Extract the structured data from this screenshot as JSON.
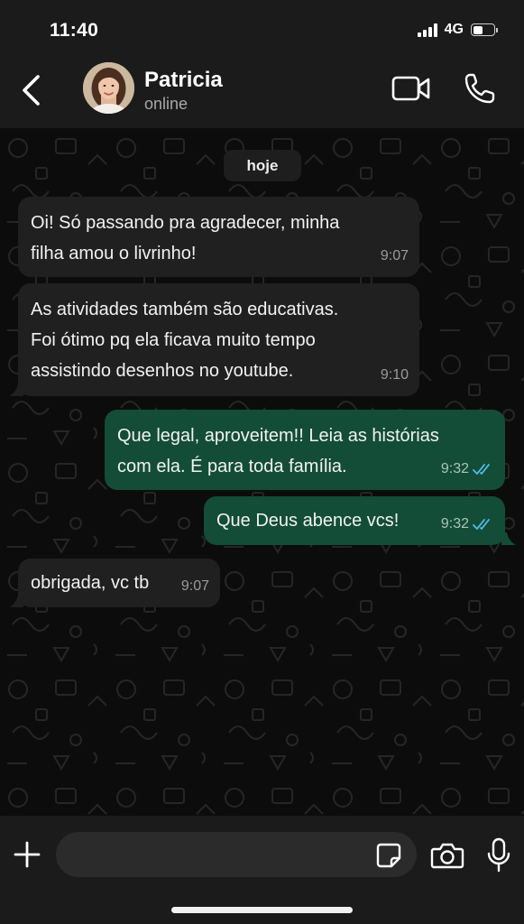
{
  "status_bar": {
    "time": "11:40",
    "network": "4G",
    "battery_level": 0.5
  },
  "header": {
    "contact_name": "Patricia",
    "contact_status": "online",
    "icons": [
      "chevron-left-icon",
      "avatar",
      "video-call-icon",
      "phone-call-icon"
    ]
  },
  "chat": {
    "date_label": "hoje",
    "messages": [
      {
        "direction": "in",
        "lines": [
          "Oi! Só passando pra agradecer, minha",
          "filha amou o livrinho!"
        ],
        "time": "9:07"
      },
      {
        "direction": "in",
        "lines": [
          "As atividades também são educativas.",
          "Foi ótimo pq ela ficava muito tempo",
          "assistindo desenhos no youtube."
        ],
        "time": "9:10"
      },
      {
        "direction": "out",
        "lines": [
          "Que legal, aproveitem!! Leia as histórias",
          "com ela. É para toda família."
        ],
        "time": "9:32",
        "status": "read"
      },
      {
        "direction": "out",
        "lines": [
          "Que Deus abence vcs!"
        ],
        "time": "9:32",
        "status": "read"
      },
      {
        "direction": "in",
        "lines": [
          "obrigada, vc tb"
        ],
        "time": "9:07"
      }
    ]
  },
  "input_bar": {
    "placeholder": "",
    "icons": [
      "plus-icon",
      "sticker-icon",
      "camera-icon",
      "microphone-icon"
    ]
  },
  "colors": {
    "incoming_bubble": "#202020",
    "outgoing_bubble": "#134d37",
    "read_ticks": "#53bdeb",
    "bars": "#1b1b1b"
  }
}
